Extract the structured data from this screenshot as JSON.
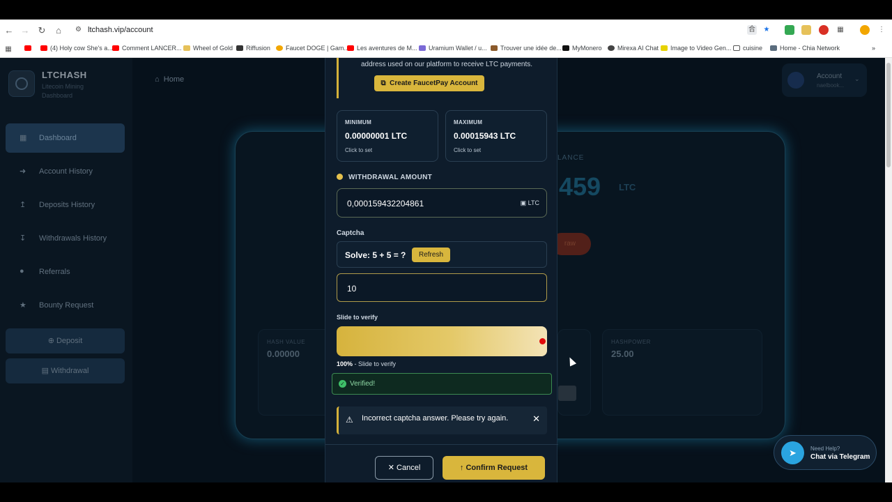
{
  "browser": {
    "url": "ltchash.vip/account",
    "bookmarks": [
      "(4) Holy cow She's a...",
      "Comment LANCER...",
      "Wheel of Gold",
      "Riffusion",
      "Faucet DOGE | Gam...",
      "Les aventures de M...",
      "Uramium Wallet / u...",
      "Trouver une idée de...",
      "MyMonero",
      "Mirexa AI Chat",
      "Image to Video Gen...",
      "cuisine",
      "Home - Chia Network"
    ]
  },
  "sidebar": {
    "brand": "LTCHASH",
    "subtitle": "Litecoin Mining Dashboard",
    "items": [
      {
        "label": "Dashboard"
      },
      {
        "label": "Account History"
      },
      {
        "label": "Deposits History"
      },
      {
        "label": "Withdrawals History"
      },
      {
        "label": "Referrals"
      },
      {
        "label": "Bounty Request"
      }
    ],
    "deposit": "Deposit",
    "withdrawal": "Withdrawal"
  },
  "topbar": {
    "home": "Home",
    "account": "Account",
    "account_sub": "naelbook..."
  },
  "dashboard": {
    "balance_label": "LANCE",
    "balance_value": "459",
    "balance_unit": "LTC",
    "withdraw_btn": "raw",
    "hash_value_label": "HASH VALUE",
    "hash_value": "0.00000",
    "hashpower_label": "HASHPOWER",
    "hashpower": "25.00"
  },
  "modal": {
    "notice": "address used on our platform to receive LTC payments.",
    "faucetpay_btn": "Create FaucetPay Account",
    "minimum": {
      "label": "MINIMUM",
      "value": "0.00000001 LTC",
      "hint": "Click to set"
    },
    "maximum": {
      "label": "MAXIMUM",
      "value": "0.00015943 LTC",
      "hint": "Click to set"
    },
    "withdrawal_label": "WITHDRAWAL AMOUNT",
    "amount": "0,000159432204861",
    "amount_unit": "LTC",
    "captcha_label": "Captcha",
    "captcha_question": "Solve: 5 + 5 = ?",
    "refresh": "Refresh",
    "captcha_answer": "10",
    "slide_label": "Slide to verify",
    "slide_percent": "100%",
    "slide_hint": " - Slide to verify",
    "slide_progress": 1.0,
    "verified": "Verified!",
    "alert": "Incorrect captcha answer. Please try again.",
    "cancel": "Cancel",
    "confirm": "Confirm Request"
  },
  "telegram": {
    "line1": "Need Help?",
    "line2": "Chat via Telegram"
  }
}
